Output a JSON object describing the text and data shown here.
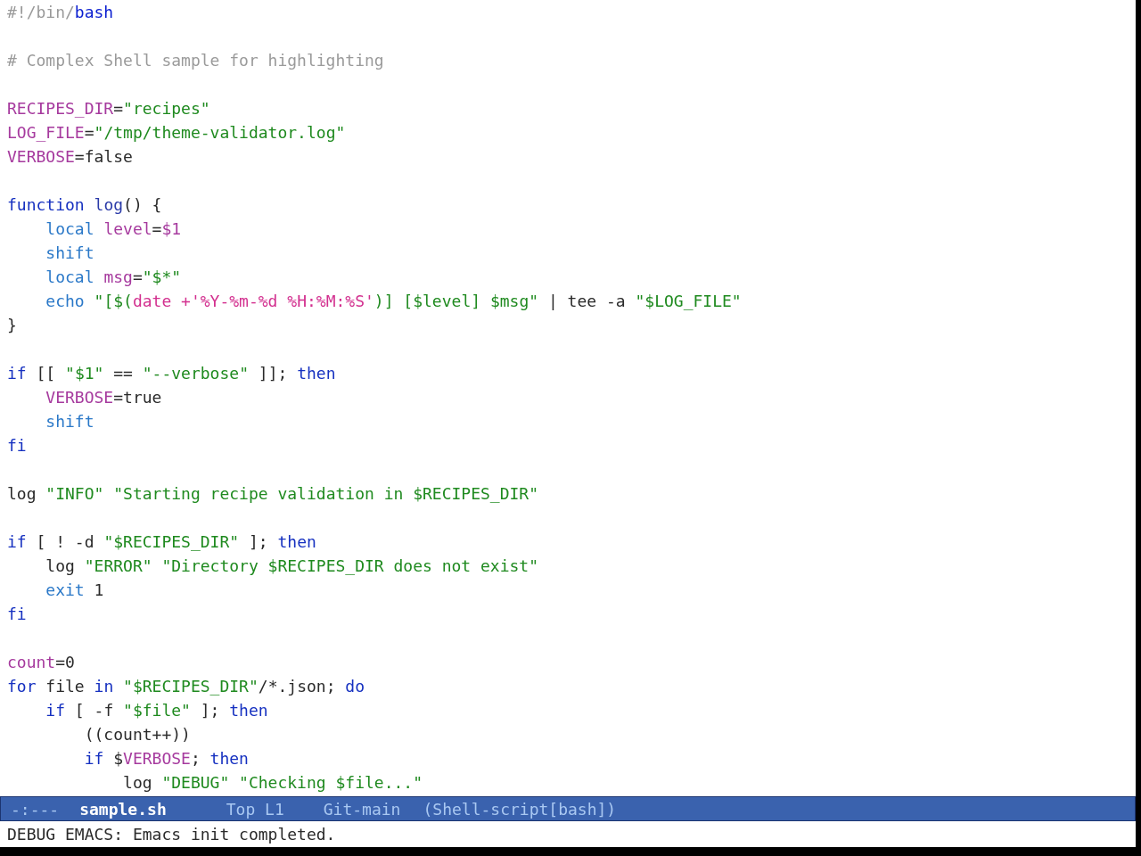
{
  "buffer": {
    "lines": [
      {
        "kind": "code",
        "segments": [
          {
            "kind": "comment",
            "text": "#!/bin/"
          },
          {
            "kind": "interpreter",
            "text": "bash"
          }
        ]
      },
      {
        "kind": "blank"
      },
      {
        "kind": "code",
        "segments": [
          {
            "kind": "comment",
            "text": "# Complex Shell sample for highlighting"
          }
        ]
      },
      {
        "kind": "blank"
      },
      {
        "kind": "code",
        "segments": [
          {
            "kind": "variable",
            "text": "RECIPES_DIR"
          },
          {
            "kind": "plain",
            "text": "="
          },
          {
            "kind": "string",
            "text": "\"recipes\""
          }
        ]
      },
      {
        "kind": "code",
        "segments": [
          {
            "kind": "variable",
            "text": "LOG_FILE"
          },
          {
            "kind": "plain",
            "text": "="
          },
          {
            "kind": "string",
            "text": "\"/tmp/theme-validator.log\""
          }
        ]
      },
      {
        "kind": "code",
        "segments": [
          {
            "kind": "variable",
            "text": "VERBOSE"
          },
          {
            "kind": "plain",
            "text": "=false"
          }
        ]
      },
      {
        "kind": "blank"
      },
      {
        "kind": "code",
        "segments": [
          {
            "kind": "keyword",
            "text": "function "
          },
          {
            "kind": "function",
            "text": "log"
          },
          {
            "kind": "plain",
            "text": "() {"
          }
        ]
      },
      {
        "kind": "code",
        "segments": [
          {
            "kind": "builtin",
            "text": "    local "
          },
          {
            "kind": "variable",
            "text": "level"
          },
          {
            "kind": "plain",
            "text": "="
          },
          {
            "kind": "variable",
            "text": "$1"
          }
        ]
      },
      {
        "kind": "code",
        "segments": [
          {
            "kind": "builtin",
            "text": "    shift"
          }
        ]
      },
      {
        "kind": "code",
        "segments": [
          {
            "kind": "builtin",
            "text": "    local "
          },
          {
            "kind": "variable",
            "text": "msg"
          },
          {
            "kind": "plain",
            "text": "="
          },
          {
            "kind": "string",
            "text": "\"$*\""
          }
        ]
      },
      {
        "kind": "code",
        "segments": [
          {
            "kind": "builtin",
            "text": "    echo "
          },
          {
            "kind": "string",
            "text": "\"[$("
          },
          {
            "kind": "substitution",
            "text": "date +'%Y-%m-%d %H:%M:%S'"
          },
          {
            "kind": "string",
            "text": ")] [$level] $msg\""
          },
          {
            "kind": "plain",
            "text": " | tee -a "
          },
          {
            "kind": "string",
            "text": "\"$LOG_FILE\""
          }
        ]
      },
      {
        "kind": "code",
        "segments": [
          {
            "kind": "plain",
            "text": "}"
          }
        ]
      },
      {
        "kind": "blank"
      },
      {
        "kind": "code",
        "segments": [
          {
            "kind": "keyword",
            "text": "if"
          },
          {
            "kind": "plain",
            "text": " [[ "
          },
          {
            "kind": "string",
            "text": "\"$1\""
          },
          {
            "kind": "plain",
            "text": " == "
          },
          {
            "kind": "string",
            "text": "\"--verbose\""
          },
          {
            "kind": "plain",
            "text": " ]]; "
          },
          {
            "kind": "keyword",
            "text": "then"
          }
        ]
      },
      {
        "kind": "code",
        "segments": [
          {
            "kind": "variable",
            "text": "    VERBOSE"
          },
          {
            "kind": "plain",
            "text": "=true"
          }
        ]
      },
      {
        "kind": "code",
        "segments": [
          {
            "kind": "builtin",
            "text": "    shift"
          }
        ]
      },
      {
        "kind": "code",
        "segments": [
          {
            "kind": "keyword",
            "text": "fi"
          }
        ]
      },
      {
        "kind": "blank"
      },
      {
        "kind": "code",
        "segments": [
          {
            "kind": "plain",
            "text": "log "
          },
          {
            "kind": "string",
            "text": "\"INFO\" \"Starting recipe validation in $RECIPES_DIR\""
          }
        ]
      },
      {
        "kind": "blank"
      },
      {
        "kind": "code",
        "segments": [
          {
            "kind": "keyword",
            "text": "if"
          },
          {
            "kind": "plain",
            "text": " [ ! -d "
          },
          {
            "kind": "string",
            "text": "\"$RECIPES_DIR\""
          },
          {
            "kind": "plain",
            "text": " ]; "
          },
          {
            "kind": "keyword",
            "text": "then"
          }
        ]
      },
      {
        "kind": "code",
        "segments": [
          {
            "kind": "plain",
            "text": "    log "
          },
          {
            "kind": "string",
            "text": "\"ERROR\" \"Directory $RECIPES_DIR does not exist\""
          }
        ]
      },
      {
        "kind": "code",
        "segments": [
          {
            "kind": "builtin",
            "text": "    exit"
          },
          {
            "kind": "plain",
            "text": " 1"
          }
        ]
      },
      {
        "kind": "code",
        "segments": [
          {
            "kind": "keyword",
            "text": "fi"
          }
        ]
      },
      {
        "kind": "blank"
      },
      {
        "kind": "code",
        "segments": [
          {
            "kind": "variable",
            "text": "count"
          },
          {
            "kind": "plain",
            "text": "=0"
          }
        ]
      },
      {
        "kind": "code",
        "segments": [
          {
            "kind": "keyword",
            "text": "for"
          },
          {
            "kind": "plain",
            "text": " file "
          },
          {
            "kind": "keyword",
            "text": "in"
          },
          {
            "kind": "string",
            "text": " \"$RECIPES_DIR\""
          },
          {
            "kind": "plain",
            "text": "/*.json; "
          },
          {
            "kind": "keyword",
            "text": "do"
          }
        ]
      },
      {
        "kind": "code",
        "segments": [
          {
            "kind": "keyword",
            "text": "    if"
          },
          {
            "kind": "plain",
            "text": " [ -f "
          },
          {
            "kind": "string",
            "text": "\"$file\""
          },
          {
            "kind": "plain",
            "text": " ]; "
          },
          {
            "kind": "keyword",
            "text": "then"
          }
        ]
      },
      {
        "kind": "code",
        "segments": [
          {
            "kind": "plain",
            "text": "        ((count++))"
          }
        ]
      },
      {
        "kind": "code",
        "segments": [
          {
            "kind": "keyword",
            "text": "        if"
          },
          {
            "kind": "plain",
            "text": " $"
          },
          {
            "kind": "variable",
            "text": "VERBOSE"
          },
          {
            "kind": "plain",
            "text": "; "
          },
          {
            "kind": "keyword",
            "text": "then"
          }
        ]
      },
      {
        "kind": "code",
        "segments": [
          {
            "kind": "plain",
            "text": "            log "
          },
          {
            "kind": "string",
            "text": "\"DEBUG\" \"Checking $file...\""
          }
        ]
      }
    ]
  },
  "mode_line": {
    "status": "-:---",
    "buffer_name": "sample.sh",
    "position": "Top L1",
    "vc": "Git-main",
    "mode": "(Shell-script[bash])"
  },
  "echo_area": {
    "message": "DEBUG EMACS: Emacs init completed."
  }
}
